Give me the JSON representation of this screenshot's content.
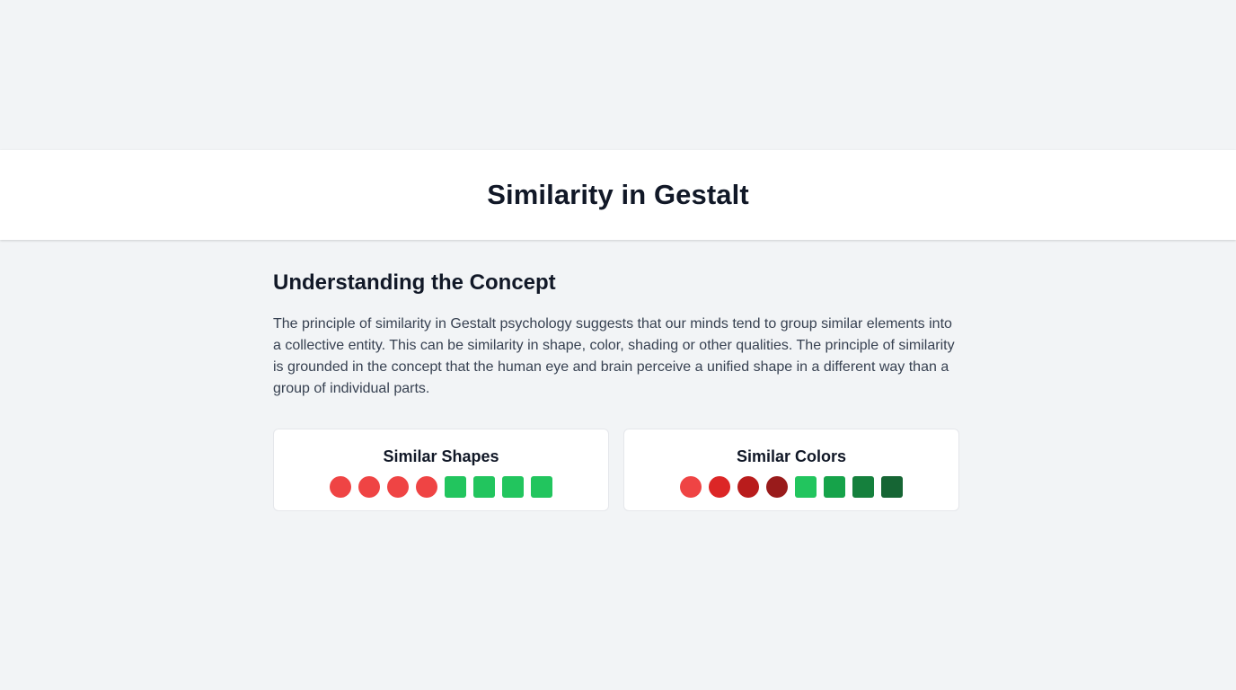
{
  "header": {
    "title": "Similarity in Gestalt"
  },
  "main": {
    "heading": "Understanding the Concept",
    "paragraph": "The principle of similarity in Gestalt psychology suggests that our minds tend to group similar elements into a collective entity. This can be similarity in shape, color, shading or other qualities. The principle of similarity is grounded in the concept that the human eye and brain perceive a unified shape in a different way than a group of individual parts."
  },
  "cards": [
    {
      "title": "Similar Shapes",
      "shapes": [
        {
          "kind": "circle",
          "color": "#ef4444"
        },
        {
          "kind": "circle",
          "color": "#ef4444"
        },
        {
          "kind": "circle",
          "color": "#ef4444"
        },
        {
          "kind": "circle",
          "color": "#ef4444"
        },
        {
          "kind": "square",
          "color": "#22c55e"
        },
        {
          "kind": "square",
          "color": "#22c55e"
        },
        {
          "kind": "square",
          "color": "#22c55e"
        },
        {
          "kind": "square",
          "color": "#22c55e"
        }
      ]
    },
    {
      "title": "Similar Colors",
      "shapes": [
        {
          "kind": "circle",
          "color": "#ef4444"
        },
        {
          "kind": "circle",
          "color": "#dc2626"
        },
        {
          "kind": "circle",
          "color": "#b91c1c"
        },
        {
          "kind": "circle",
          "color": "#991b1b"
        },
        {
          "kind": "square",
          "color": "#22c55e"
        },
        {
          "kind": "square",
          "color": "#16a34a"
        },
        {
          "kind": "square",
          "color": "#15803d"
        },
        {
          "kind": "square",
          "color": "#166534"
        }
      ]
    }
  ]
}
